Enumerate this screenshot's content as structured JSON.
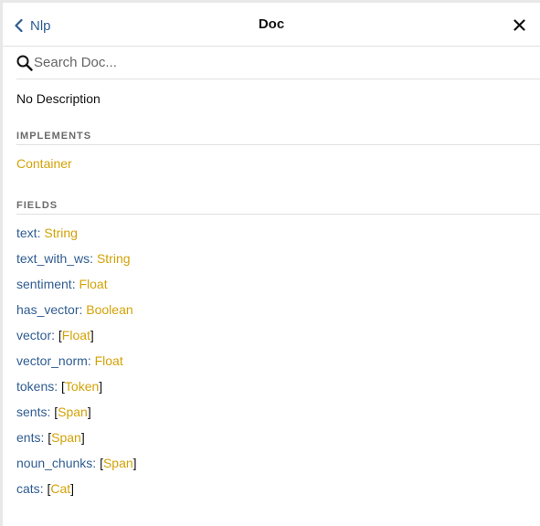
{
  "header": {
    "back_label": "Nlp",
    "title": "Doc"
  },
  "search": {
    "placeholder": "Search Doc..."
  },
  "description": "No Description",
  "implements": {
    "heading": "IMPLEMENTS",
    "items": [
      "Container"
    ]
  },
  "fields": {
    "heading": "FIELDS",
    "items": [
      {
        "name": "text",
        "type": "String",
        "list": false
      },
      {
        "name": "text_with_ws",
        "type": "String",
        "list": false
      },
      {
        "name": "sentiment",
        "type": "Float",
        "list": false
      },
      {
        "name": "has_vector",
        "type": "Boolean",
        "list": false
      },
      {
        "name": "vector",
        "type": "Float",
        "list": true
      },
      {
        "name": "vector_norm",
        "type": "Float",
        "list": false
      },
      {
        "name": "tokens",
        "type": "Token",
        "list": true
      },
      {
        "name": "sents",
        "type": "Span",
        "list": true
      },
      {
        "name": "ents",
        "type": "Span",
        "list": true
      },
      {
        "name": "noun_chunks",
        "type": "Span",
        "list": true
      },
      {
        "name": "cats",
        "type": "Cat",
        "list": true
      }
    ]
  },
  "colors": {
    "field_name": "#2f5c91",
    "type": "#d4a207",
    "heading": "#6a6a6a"
  }
}
